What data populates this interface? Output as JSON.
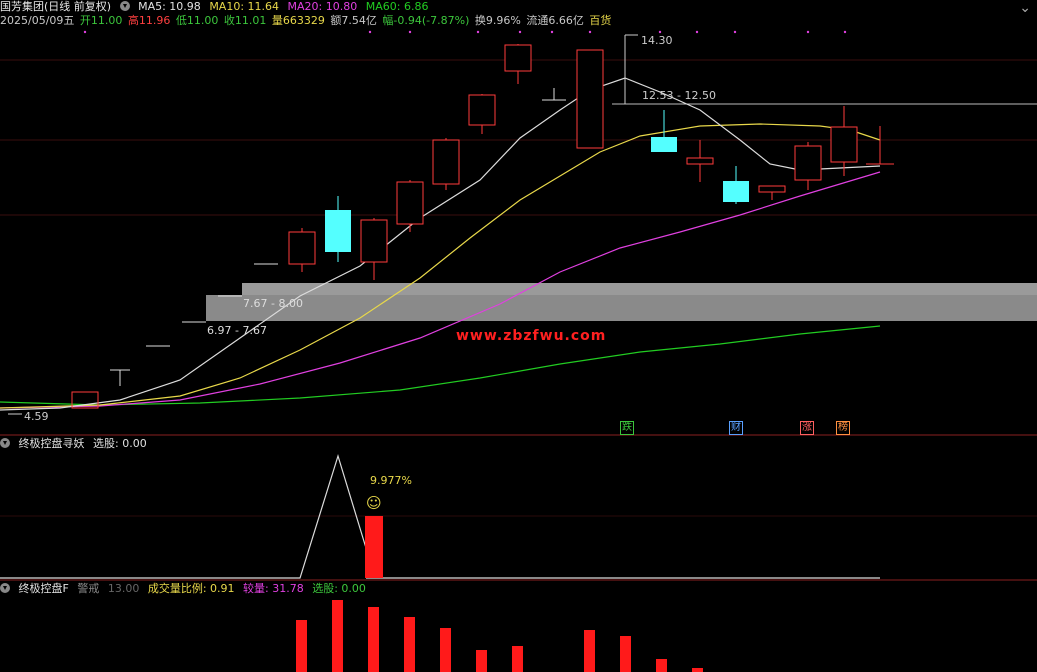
{
  "header": {
    "title": "国芳集团(日线 前复权)",
    "ma5": "MA5: 10.98",
    "ma10": "MA10: 11.64",
    "ma20": "MA20: 10.80",
    "ma60": "MA60: 6.86",
    "date": "2025/05/09五",
    "open": "开11.00",
    "high": "高11.96",
    "low": "低11.00",
    "close": "收11.01",
    "volume": "量663329",
    "amount": "额7.54亿",
    "change": "幅-0.94(-7.87%)",
    "turnover": "换9.96%",
    "float_cap": "流通6.66亿",
    "industry": "百货"
  },
  "main_chart": {
    "watermark": "www.zbzfwu.com",
    "peak_label": "14.30",
    "zone_top_label": "12.53 - 12.50",
    "zone_mid_label": "7.67 - 8.00",
    "zone_low_label": "6.97 - 7.67",
    "low_label": "4.59",
    "markers": [
      {
        "text": "跌",
        "color": "#3cc63c"
      },
      {
        "text": "财",
        "color": "#5aa0ff"
      },
      {
        "text": "涨",
        "color": "#ff6060"
      },
      {
        "text": "榜",
        "color": "#ff9040"
      }
    ],
    "colors": {
      "up": "#ff3b3b",
      "down": "#54ffff",
      "ma5": "#dcdcdc",
      "ma10": "#e8d84a",
      "ma20": "#e040e0",
      "ma60": "#22cc22"
    }
  },
  "panel1": {
    "title": "终极控盘寻妖",
    "pick": "选股: 0.00",
    "annotation": "9.977%",
    "emoji": "☺"
  },
  "panel2": {
    "title": "终极控盘F",
    "warn": "警戒",
    "warn_val": "13.00",
    "ratio": "成交量比例: 0.91",
    "vol": "较量: 31.78",
    "pick": "选股: 0.00"
  },
  "window": {
    "close_icon": "⌄"
  }
}
